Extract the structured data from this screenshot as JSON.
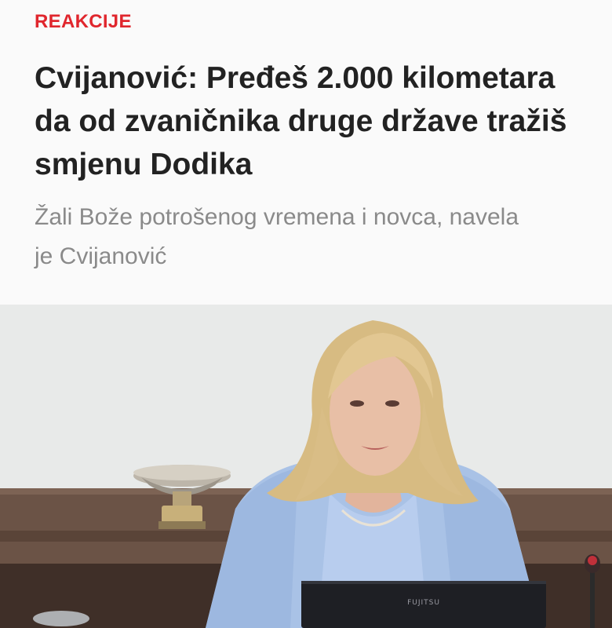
{
  "article": {
    "category": "REAKCIJE",
    "headline": "Cvijanović: Pređeš 2.000 kilometara da od zvaničnika druge države tražiš smjenu Dodika",
    "subtitle": "Žali Bože potrošenog vremena i novca, navela je Cvijanović"
  },
  "photo": {
    "laptop_brand": "FUJITSU"
  },
  "colors": {
    "category_accent": "#e0262d",
    "headline_text": "#222222",
    "subtitle_text": "#8a8a8a"
  }
}
